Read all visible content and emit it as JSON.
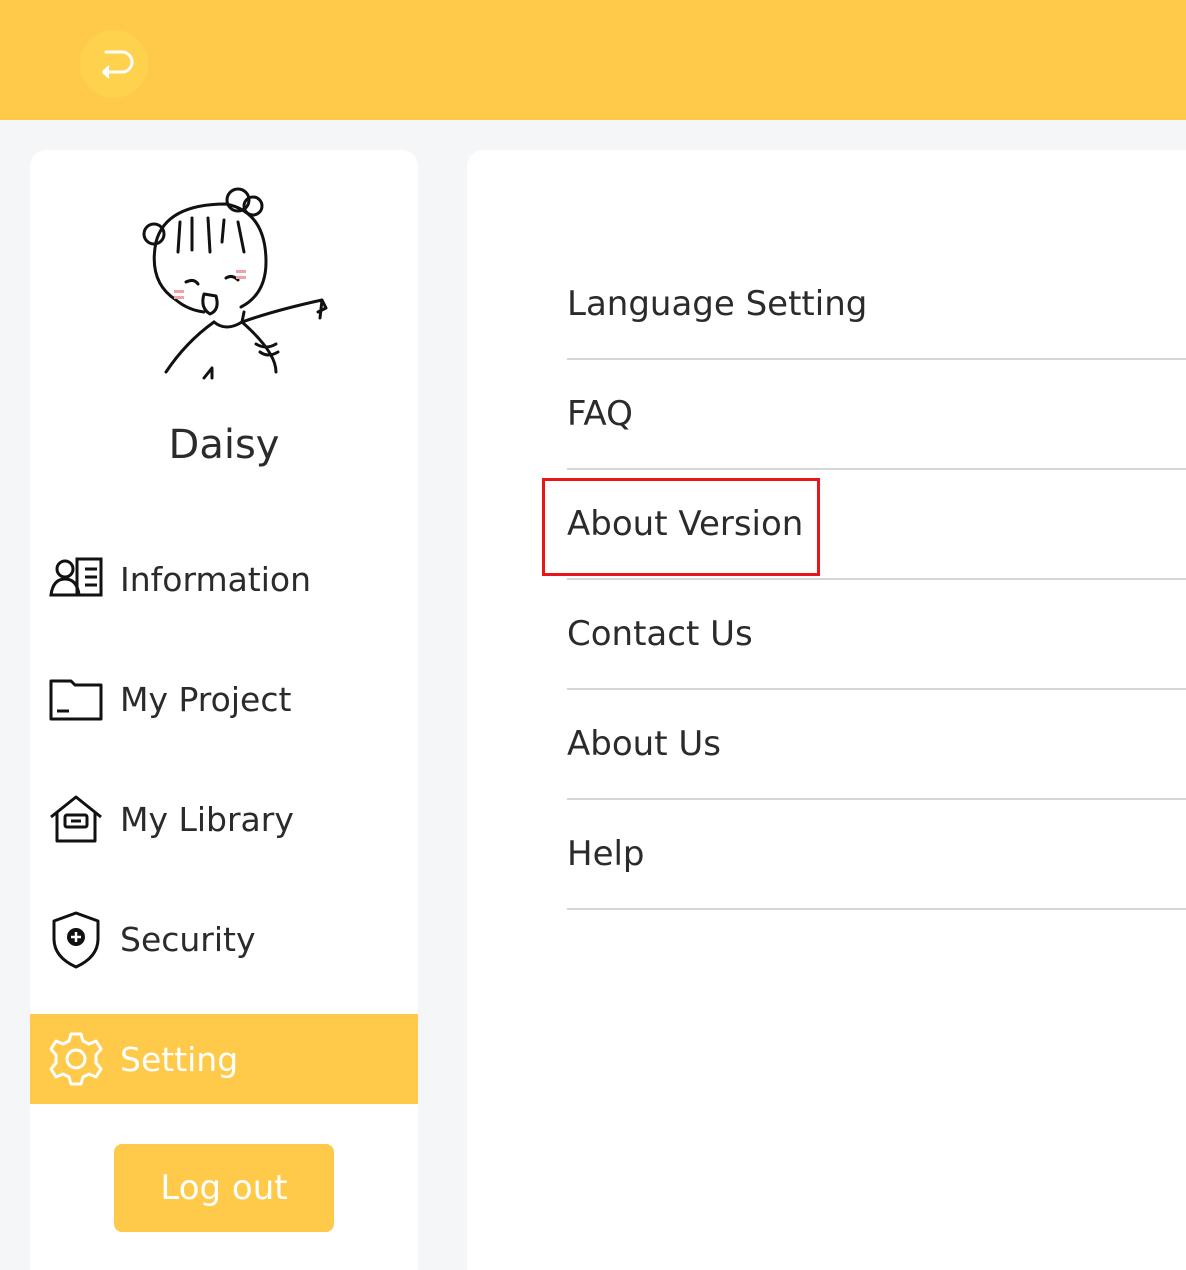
{
  "header": {
    "back_icon": "return-arrow-icon"
  },
  "sidebar": {
    "username": "Daisy",
    "items": [
      {
        "label": "Information",
        "icon": "contact-card-icon",
        "active": false
      },
      {
        "label": "My Project",
        "icon": "folder-icon",
        "active": false
      },
      {
        "label": "My Library",
        "icon": "house-icon",
        "active": false
      },
      {
        "label": "Security",
        "icon": "shield-plus-icon",
        "active": false
      },
      {
        "label": "Setting",
        "icon": "gear-icon",
        "active": true
      }
    ],
    "logout_label": "Log out"
  },
  "settings_menu": {
    "items": [
      {
        "label": "Language Setting"
      },
      {
        "label": "FAQ"
      },
      {
        "label": "About Version"
      },
      {
        "label": "Contact Us"
      },
      {
        "label": "About Us"
      },
      {
        "label": "Help"
      }
    ],
    "highlighted_item": "About Version"
  },
  "colors": {
    "accent": "#ffca4a",
    "highlight_border": "#e8151b",
    "text": "#2b2b2b"
  }
}
